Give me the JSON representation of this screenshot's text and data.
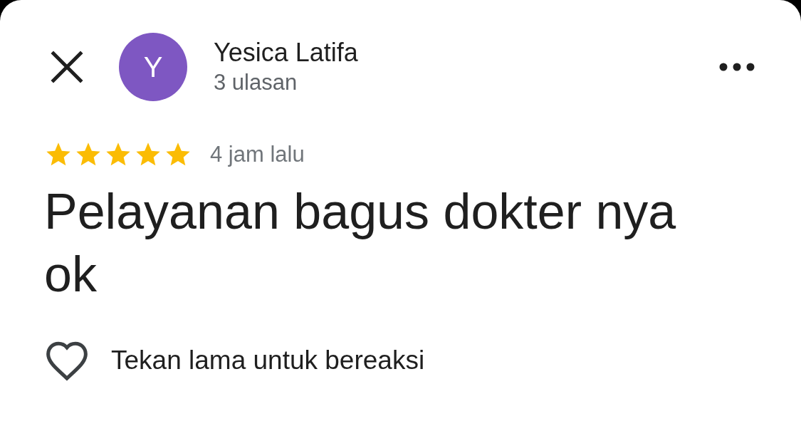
{
  "reviewer": {
    "name": "Yesica Latifa",
    "initial": "Y",
    "color": "#7e57c2",
    "review_count": "3 ulasan"
  },
  "review": {
    "stars": 5,
    "time": "4 jam lalu",
    "text": "Pelayanan bagus dokter nya ok"
  },
  "reaction": {
    "hint": "Tekan lama untuk bereaksi"
  }
}
